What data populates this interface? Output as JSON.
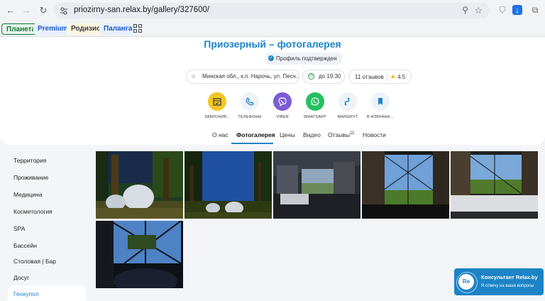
{
  "browser": {
    "url": "priozirny-san.relax.by/gallery/327600/",
    "bookmarks": [
      "Планета",
      "Premium",
      "Родизио",
      "Паланга"
    ]
  },
  "header": {
    "title": "Приозерный – фотогалерея",
    "verified": "Профиль подтвержден",
    "address": "Минская обл., к.п. Нарочь, ул. Песч...",
    "hours": "до 19:30",
    "reviews": "11 отзывов",
    "rating": "4.5",
    "actions": [
      {
        "label": "ЗАБРОНИР...",
        "icon": "calendar-icon",
        "color": "#f3c623"
      },
      {
        "label": "ТЕЛЕФОНЫ",
        "icon": "phone-icon",
        "color": "#eef3f8"
      },
      {
        "label": "VIBER",
        "icon": "viber-icon",
        "color": "#7b5cd6"
      },
      {
        "label": "WHATSAPP",
        "icon": "whatsapp-icon",
        "color": "#25c05f"
      },
      {
        "label": "МАРШРУТ",
        "icon": "route-icon",
        "color": "#eef3f8"
      },
      {
        "label": "В ИЗБРАНН...",
        "icon": "bookmark-icon",
        "color": "#eef3f8"
      }
    ],
    "tabs": [
      "О нас",
      "Фотогалерея",
      "Цены",
      "Видео",
      "Отзывы",
      "Новости"
    ],
    "reviews_tab_count": "11"
  },
  "sidebar": {
    "items": [
      "Территория",
      "Проживание",
      "Медицина",
      "Косметология",
      "SPA",
      "Бассейн",
      "Столовая | Бар",
      "Досуг",
      "Геокупол"
    ]
  },
  "chat": {
    "avatar": "Re",
    "title": "Консультант Relax.by",
    "subtitle": "Я отвечу на ваши вопросы"
  },
  "colors": {
    "accent": "#1c84c6"
  }
}
